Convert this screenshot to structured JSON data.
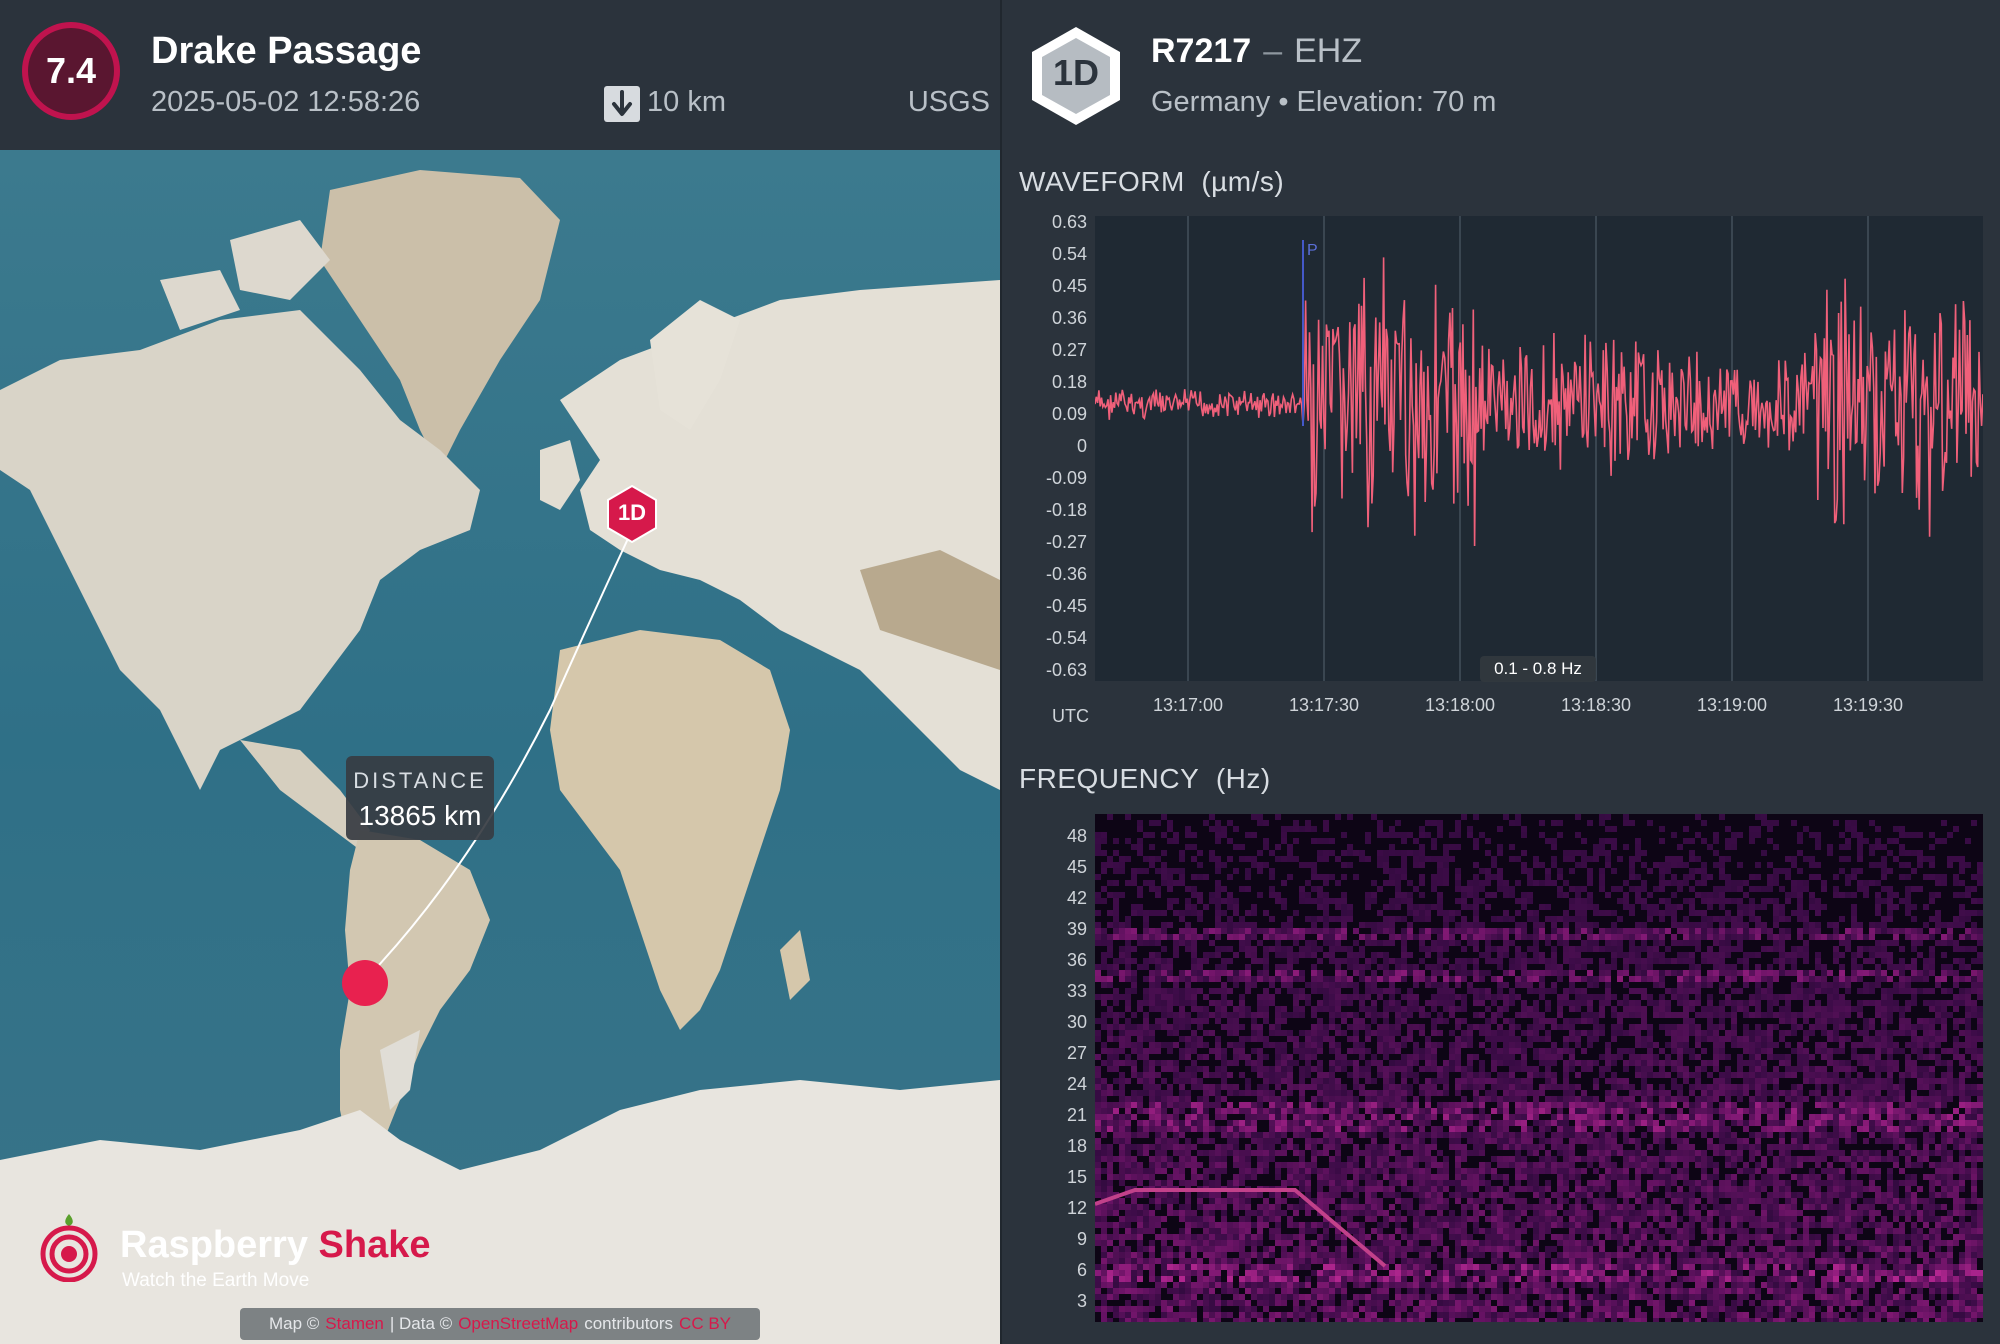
{
  "event": {
    "magnitude": "7.4",
    "title": "Drake Passage",
    "time": "2025-05-02 12:58:26",
    "depth": "10 km",
    "source": "USGS",
    "magnitude_color": "#c0134e"
  },
  "map": {
    "station_badge": "1D",
    "distance_label": "DISTANCE",
    "distance_value": "13865 km",
    "logo_name_1": "Raspberry",
    "logo_name_2": "Shake",
    "logo_tagline": "Watch the Earth Move",
    "attribution": {
      "map_prefix": "Map ©",
      "map_link": "Stamen",
      "data_prefix": "| Data ©",
      "data_link": "OpenStreetMap",
      "data_suffix": "contributors",
      "license_link": "CC BY"
    }
  },
  "station": {
    "badge": "1D",
    "code": "R7217",
    "separator": "–",
    "channel": "EHZ",
    "location": "Germany • Elevation: 70 m"
  },
  "waveform": {
    "title": "WAVEFORM",
    "unit": "(µm/s)",
    "utc_label": "UTC",
    "band": "0.1 - 0.8 Hz",
    "p_marker": "P",
    "y_ticks": [
      "0.63",
      "0.54",
      "0.45",
      "0.36",
      "0.27",
      "0.18",
      "0.09",
      "0",
      "-0.09",
      "-0.18",
      "-0.27",
      "-0.36",
      "-0.45",
      "-0.54",
      "-0.63"
    ],
    "x_ticks": [
      "13:17:00",
      "13:17:30",
      "13:18:00",
      "13:18:30",
      "13:19:00",
      "13:19:30"
    ],
    "trace_color": "#f0607a"
  },
  "frequency": {
    "title": "FREQUENCY",
    "unit": "(Hz)",
    "y_ticks": [
      "48",
      "45",
      "42",
      "39",
      "36",
      "33",
      "30",
      "27",
      "24",
      "21",
      "18",
      "15",
      "12",
      "9",
      "6",
      "3"
    ]
  }
}
